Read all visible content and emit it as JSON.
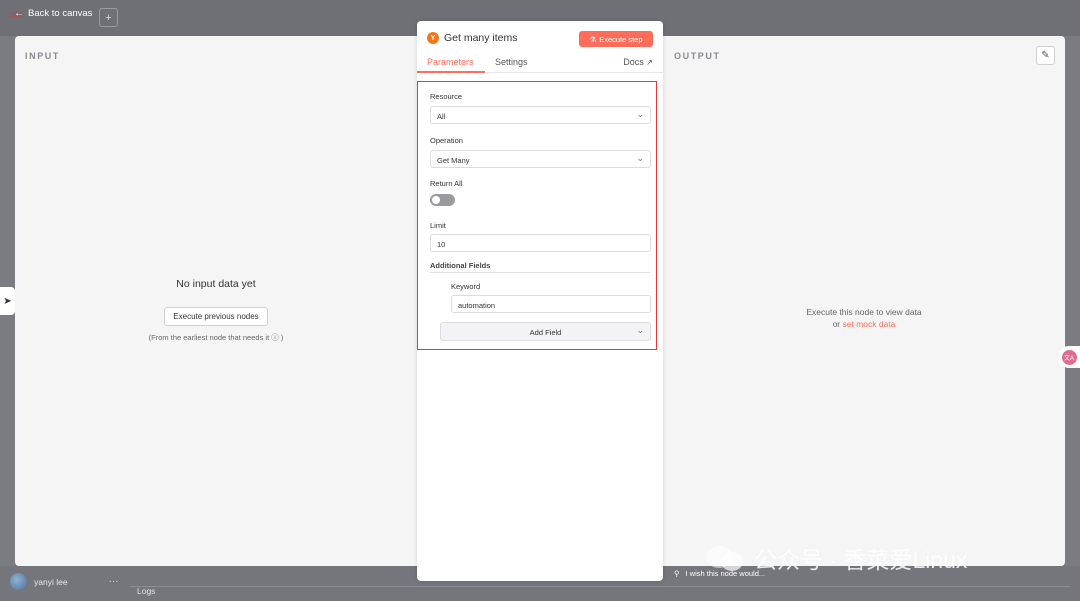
{
  "topbar": {
    "back_label": "Back to canvas",
    "plus": "+"
  },
  "input_panel": {
    "title": "INPUT",
    "empty_message": "No input data yet",
    "execute_previous_label": "Execute previous nodes",
    "hint": "(From the earliest node that needs it ⓘ )"
  },
  "output_panel": {
    "title": "OUTPUT",
    "message_line1": "Execute this node to view data",
    "message_or": "or ",
    "mock_link": "set mock data"
  },
  "node": {
    "icon_letter": "Y",
    "icon_color": "#f5761a",
    "title": "Get many items",
    "execute_label": "Execute step",
    "tabs": [
      {
        "label": "Parameters",
        "active": true
      },
      {
        "label": "Settings",
        "active": false
      }
    ],
    "docs_label": "Docs",
    "params": {
      "resource_label": "Resource",
      "resource_value": "All",
      "operation_label": "Operation",
      "operation_value": "Get Many",
      "return_all_label": "Return All",
      "return_all_on": false,
      "limit_label": "Limit",
      "limit_value": "10",
      "additional_fields_label": "Additional Fields",
      "keyword_label": "Keyword",
      "keyword_value": "automation",
      "add_field_label": "Add Field"
    }
  },
  "footer": {
    "wish": "I wish this node would...",
    "user": "yanyi lee",
    "logs": "Logs"
  },
  "watermark": "公众号 · 香菜爱Linux",
  "accent": "#ff6d5a",
  "highlight_border": "#e53935"
}
